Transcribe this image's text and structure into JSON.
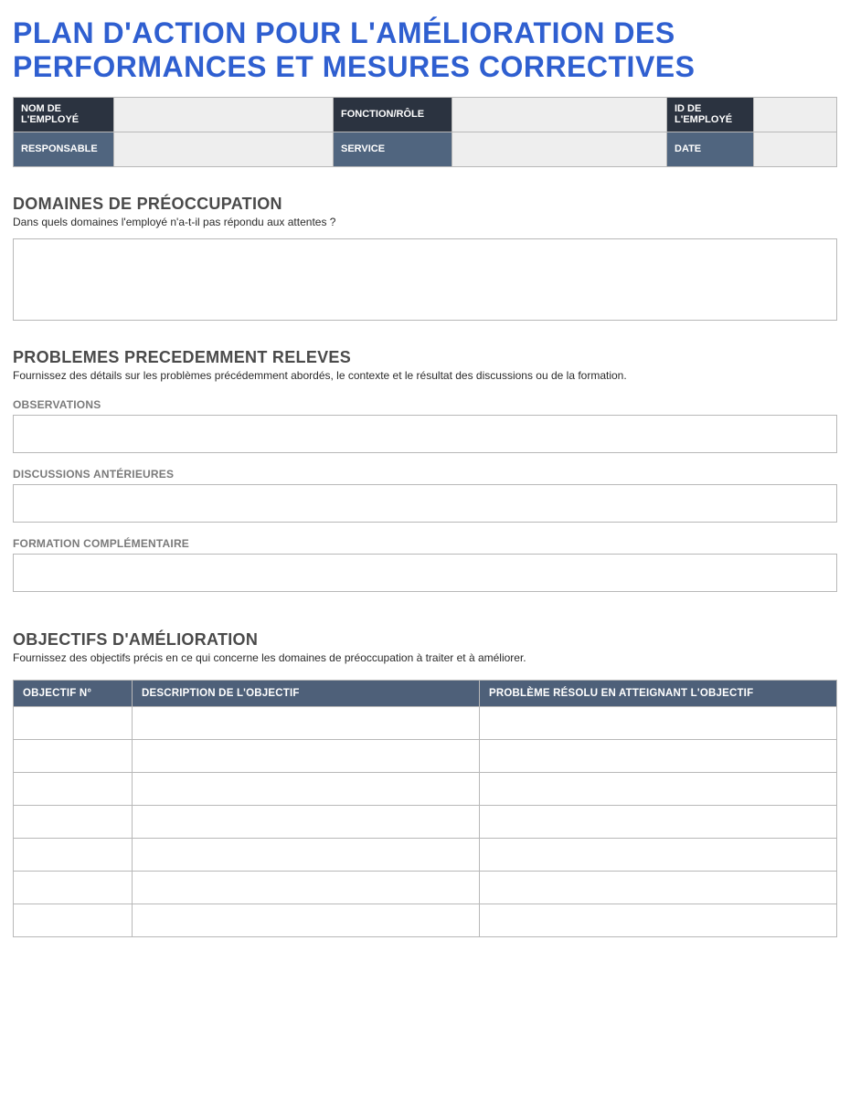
{
  "title": "PLAN D'ACTION POUR L'AMÉLIORATION DES PERFORMANCES ET MESURES CORRECTIVES",
  "info_row1": {
    "employee_name_label": "NOM DE L'EMPLOYÉ",
    "employee_name_value": "",
    "role_label": "FONCTION/RÔLE",
    "role_value": "",
    "employee_id_label": "ID DE L'EMPLOYÉ",
    "employee_id_value": ""
  },
  "info_row2": {
    "manager_label": "RESPONSABLE",
    "manager_value": "",
    "service_label": "SERVICE",
    "service_value": "",
    "date_label": "DATE",
    "date_value": ""
  },
  "areas_of_concern": {
    "heading": "DOMAINES DE PRÉOCCUPATION",
    "description": "Dans quels domaines l'employé n'a-t-il pas répondu aux attentes ?",
    "value": ""
  },
  "prev_issues": {
    "heading": "PROBLEMES PRECEDEMMENT RELEVES",
    "description": "Fournissez des détails sur les problèmes précédemment abordés, le contexte et le résultat des discussions ou de la formation.",
    "observations_label": "OBSERVATIONS",
    "observations_value": "",
    "discussions_label": "DISCUSSIONS ANTÉRIEURES",
    "discussions_value": "",
    "training_label": "FORMATION COMPLÉMENTAIRE",
    "training_value": ""
  },
  "objectives": {
    "heading": "OBJECTIFS D'AMÉLIORATION",
    "description": "Fournissez des objectifs précis en ce qui concerne les domaines de préoccupation à traiter et à améliorer.",
    "columns": {
      "num": "OBJECTIF N°",
      "desc": "DESCRIPTION DE L'OBJECTIF",
      "problem": "PROBLÈME RÉSOLU EN ATTEIGNANT L'OBJECTIF"
    },
    "rows": [
      {
        "num": "",
        "desc": "",
        "problem": ""
      },
      {
        "num": "",
        "desc": "",
        "problem": ""
      },
      {
        "num": "",
        "desc": "",
        "problem": ""
      },
      {
        "num": "",
        "desc": "",
        "problem": ""
      },
      {
        "num": "",
        "desc": "",
        "problem": ""
      },
      {
        "num": "",
        "desc": "",
        "problem": ""
      },
      {
        "num": "",
        "desc": "",
        "problem": ""
      }
    ]
  }
}
